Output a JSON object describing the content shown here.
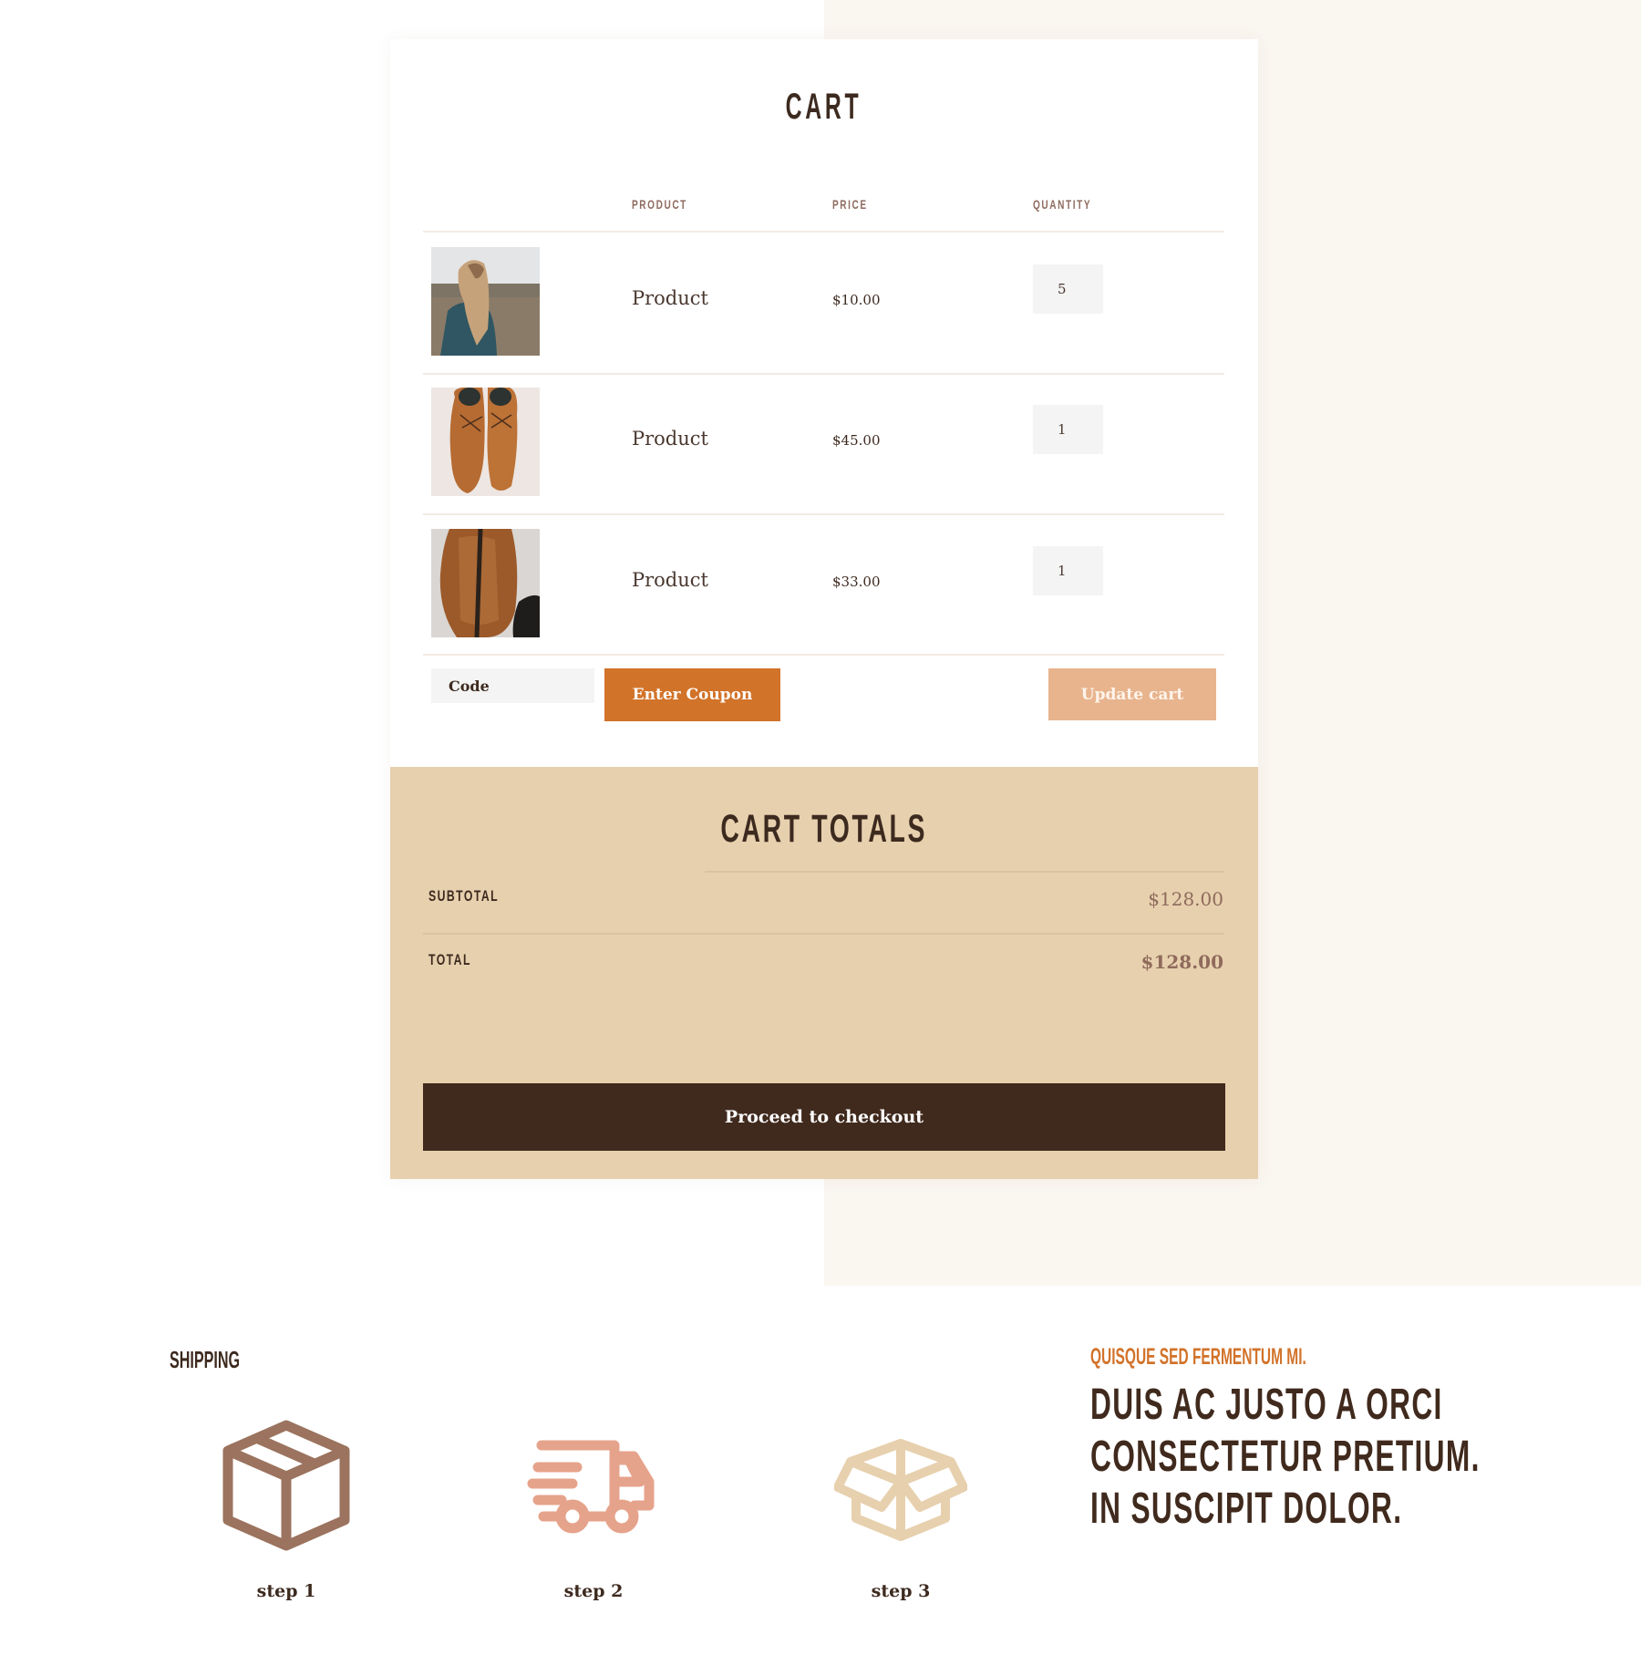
{
  "cart": {
    "title": "CART",
    "headers": {
      "product": "PRODUCT",
      "price": "PRICE",
      "quantity": "QUANTITY"
    },
    "items": [
      {
        "image": "woman-in-field-photo",
        "name": "Product",
        "price": "$10.00",
        "quantity": "5"
      },
      {
        "image": "leather-shoes-photo",
        "name": "Product",
        "price": "$45.00",
        "quantity": "1"
      },
      {
        "image": "leather-bag-photo",
        "name": "Product",
        "price": "$33.00",
        "quantity": "1"
      }
    ],
    "coupon": {
      "placeholder": "Code",
      "button_label": "Enter Coupon"
    },
    "update_label": "Update cart"
  },
  "totals": {
    "title": "CART TOTALS",
    "subtotal_label": "SUBTOTAL",
    "subtotal_value": "$128.00",
    "total_label": "TOTAL",
    "total_value": "$128.00",
    "checkout_label": "Proceed to checkout"
  },
  "shipping": {
    "title": "SHIPPING",
    "steps": [
      {
        "icon": "closed-box-icon",
        "label": "step 1",
        "color": "#9b735e"
      },
      {
        "icon": "delivery-truck-icon",
        "label": "step 2",
        "color": "#e6a38b"
      },
      {
        "icon": "open-box-icon",
        "label": "step 3",
        "color": "#e7d0ae"
      }
    ]
  },
  "promo": {
    "kicker": "QUISQUE SED FERMENTUM MI.",
    "headline_lines": [
      "DUIS AC JUSTO A ORCI",
      "CONSECTETUR PRETIUM.",
      "IN SUSCIPIT DOLOR."
    ]
  },
  "colors": {
    "accent": "#d2732a",
    "accent_light": "#e8b48e",
    "dark": "#402a1d",
    "sand": "#e7d0ae",
    "cream": "#faf6f0"
  }
}
